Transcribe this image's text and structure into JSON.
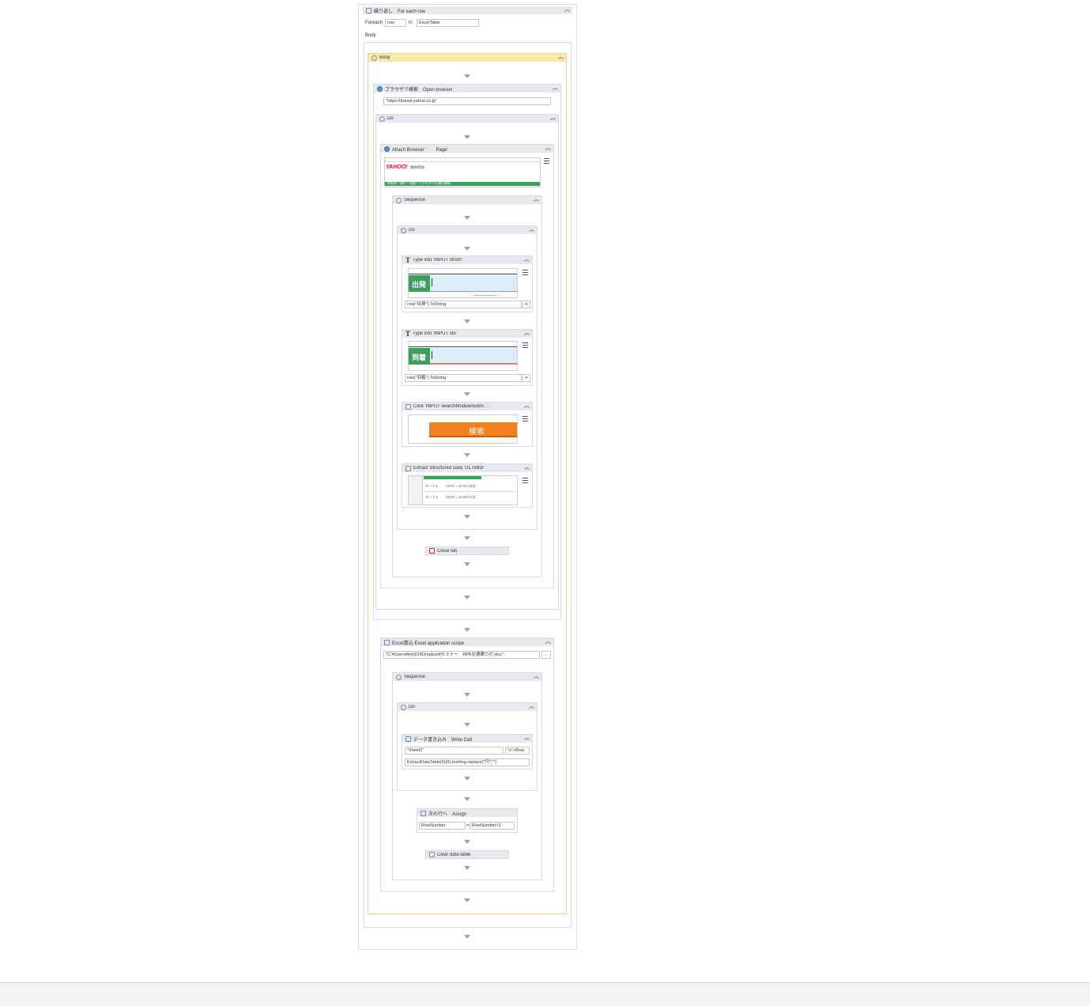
{
  "foreach": {
    "title": "繰り返し　For each row",
    "foreach_label": "Foreach",
    "item_var": "row",
    "in_label": "in",
    "collection": "ExcelTable",
    "body_label": "Body"
  },
  "body": {
    "title": "Body"
  },
  "open_browser": {
    "title": "ブラウザで検索　Open browser",
    "url": "\"https://transit.yahoo.co.jp\""
  },
  "do1": {
    "title": "Do"
  },
  "attach_browser": {
    "title": "Attach Browser '　　Page'",
    "preview_logo": "YAHOO!",
    "preview_tagline": "路線情報",
    "preview_nav": "時刻表・運行・地図・リアルタイム運行情報"
  },
  "sequence1": {
    "title": "Sequence"
  },
  "do2": {
    "title": "Do"
  },
  "type_from": {
    "title": "Type into 'INPUT  sfrom'",
    "field_label": "出発",
    "value": "row(\"出発\").ToString",
    "add": "+"
  },
  "type_to": {
    "title": "Type into 'INPUT  sto'",
    "field_label": "到着",
    "value": "row(\"到着\").ToString",
    "add": "+"
  },
  "click_search": {
    "title": "Click 'INPUT  searchModuleSubm...'",
    "button_label": "検索"
  },
  "extract": {
    "title": "Extract Structured Data 'UL  rsltlst'",
    "row1": "ルート1",
    "row1_detail": "12:07→12:23 16分",
    "row2": "ルート2",
    "row2_detail": "12:07→12:28 21分"
  },
  "close_tab": {
    "title": "Close tab"
  },
  "excel_scope": {
    "title": "Excel書込 Excel application scope",
    "path": "\"C:¥Users¥info01¥Dropbox¥セミナー　RPA交通費ロボ.xlsx\"",
    "browse": "..."
  },
  "sequence2": {
    "title": "Sequence"
  },
  "do3": {
    "title": "Do"
  },
  "write_cell": {
    "title": "データ書き込み　Write Cell",
    "sheet": "\"Sheet1\"",
    "cell": "\"e\"+Row",
    "value": "ExtractDataTable(0)(0).tostring.replace(\"円\",\"\")"
  },
  "assign": {
    "title": "次の行へ　Assign",
    "left": "RowNumber",
    "op": "=",
    "right": "RowNumber+1"
  },
  "clear_table": {
    "title": "Clear data table"
  },
  "colors": {
    "header": "#e6e9ed",
    "body_header": "#fbe9a9",
    "yahoo_green": "#3e9e5c",
    "search_orange": "#f3801f"
  }
}
